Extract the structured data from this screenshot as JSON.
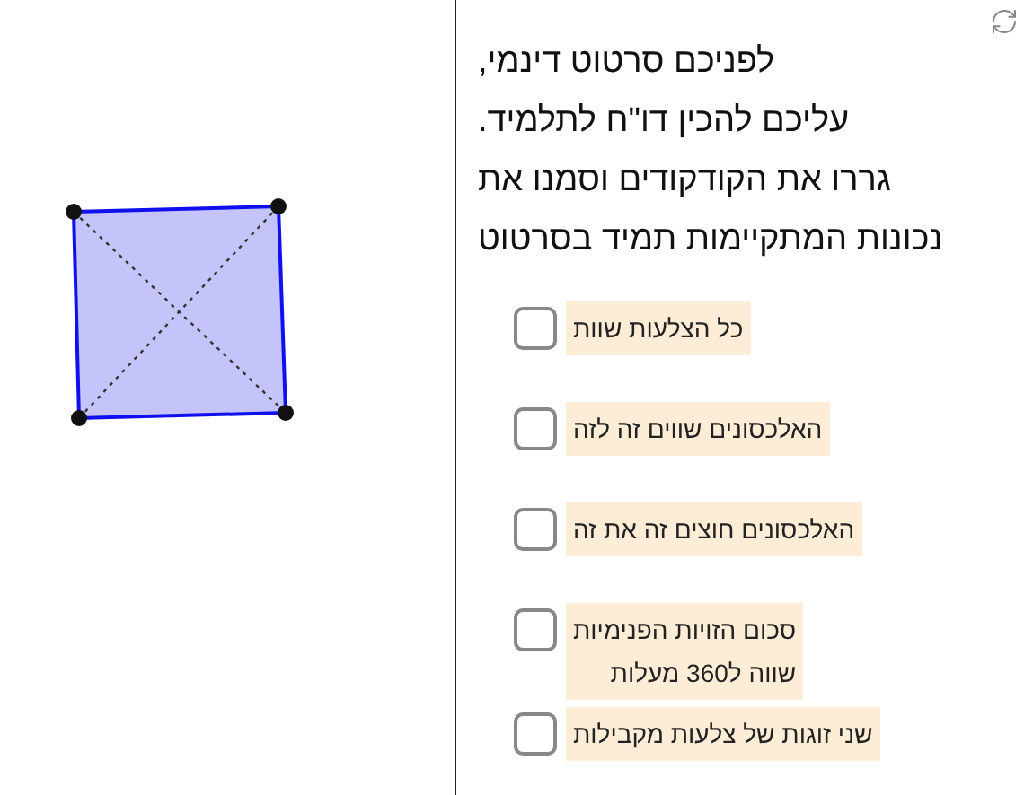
{
  "instructions": [
    "לפניכם סרטוט דינמי,",
    "עליכם להכין  דו\"ח לתלמיד.",
    "גררו את הקודקודים וסמנו את",
    "נכונות המתקיימות תמיד בסרטוט"
  ],
  "options": [
    {
      "label": "כל הצלעות שוות",
      "checked": false
    },
    {
      "label": "האלכסונים שווים זה לזה",
      "checked": false
    },
    {
      "label": "האלכסונים חוצים זה את זה",
      "checked": false
    },
    {
      "label": "סכום הזויות הפנימיות\nשווה ל360 מעלות",
      "checked": false
    },
    {
      "label": "שני זוגות של צלעות מקבילות",
      "checked": false
    }
  ]
}
